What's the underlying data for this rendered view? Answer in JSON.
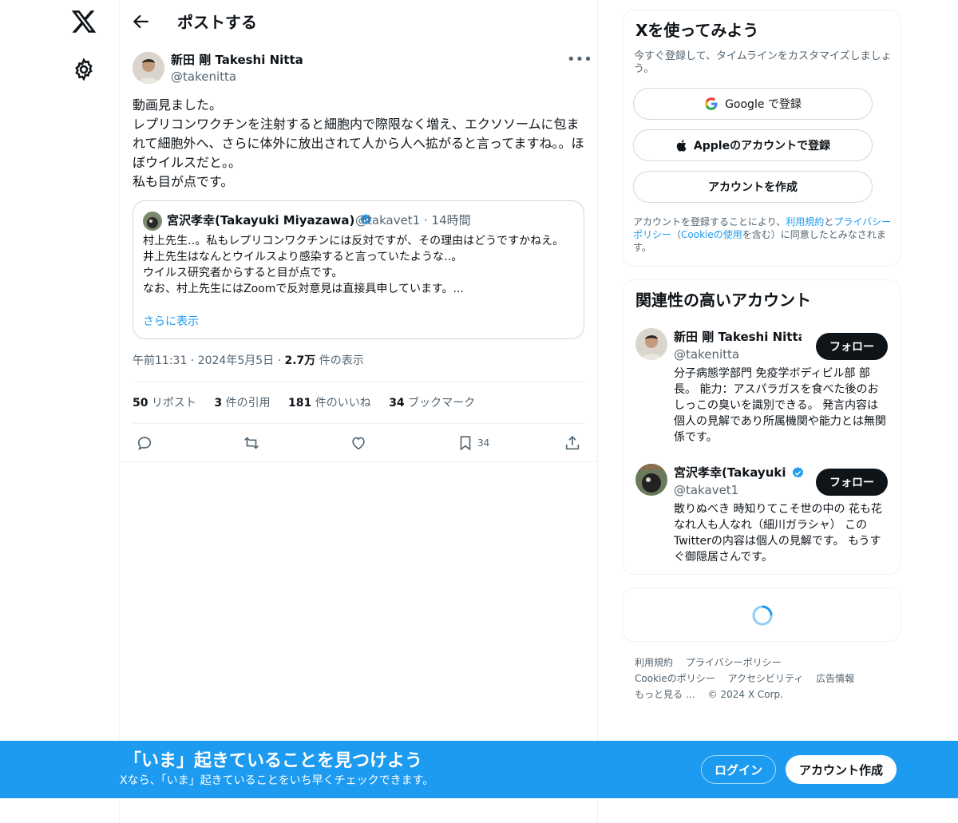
{
  "colors": {
    "accent": "#1d9bf0",
    "text": "#0f1419",
    "muted": "#536471",
    "border": "#eff3f4"
  },
  "nav": {
    "logo_icon": "x-logo-icon",
    "settings_icon": "gear-icon"
  },
  "header": {
    "title": "ポストする",
    "back_icon": "arrow-left-icon"
  },
  "post": {
    "author_name": "新田 剛 Takeshi Nitta",
    "author_handle": "@takenitta",
    "more_label": "•••",
    "text": "動画見ました。\nレプリコンワクチンを注射すると細胞内で際限なく増え、エクソソームに包まれて細胞外へ、さらに体外に放出されて人から人へ拡がると言ってますね。。ほぼウイルスだと。。\n私も目が点です。",
    "quote": {
      "author_name": "宮沢孝幸(Takayuki Miyazawa)",
      "author_handle": "@takavet1",
      "time": "14時間",
      "text": "村上先生‥。私もレプリコンワクチンには反対ですが、その理由はどうですかねえ。\n井上先生はなんとウイルスより感染すると言っていたような‥。\nウイルス研究者からすると目が点です。\nなお、村上先生にはZoomで反対意見は直接具申しています。...",
      "show_more": "さらに表示"
    },
    "timestamp": "午前11:31 · 2024年5月5日 · ",
    "views_count": "2.7万",
    "views_label": " 件の表示",
    "stats": [
      {
        "count": "50",
        "label": " リポスト"
      },
      {
        "count": "3",
        "label": " 件の引用"
      },
      {
        "count": "181",
        "label": " 件のいいね"
      },
      {
        "count": "34",
        "label": " ブックマーク"
      }
    ],
    "bookmark_count": "34"
  },
  "signup": {
    "title": "Xを使ってみよう",
    "subtitle": "今すぐ登録して、タイムラインをカスタマイズしましょう。",
    "google_label": "Google で登録",
    "apple_label": "Appleのアカウントで登録",
    "create_label": "アカウントを作成",
    "terms_pre": "アカウントを登録することにより、",
    "terms_link": "利用規約",
    "terms_and": "と",
    "privacy_link": "プライバシーポリシー",
    "terms_mid": "（",
    "cookie_link": "Cookieの使用",
    "terms_post": "を含む）に同意したとみなされます。"
  },
  "relevant": {
    "title": "関連性の高いアカウント",
    "accounts": [
      {
        "name": "新田 剛 Takeshi Nitta",
        "handle": "@takenitta",
        "follow": "フォロー",
        "bio": "分子病態学部門 免疫学ボディビル部 部長。 能力：アスパラガスを食べた後のおしっこの臭いを識別できる。 発言内容は個人の見解であり所属機関や能力とは無関係です。"
      },
      {
        "name": "宮沢孝幸(Takayuki Miyazawa)",
        "handle": "@takavet1",
        "follow": "フォロー",
        "bio": "散りぬべき 時知りてこそ世の中の 花も花なれ人も人なれ（細川ガラシャ） このTwitterの内容は個人の見解です。 もうすぐ御隠居さんです。"
      }
    ]
  },
  "footer": {
    "links_row1": [
      "利用規約",
      "プライバシーポリシー"
    ],
    "links_row2": [
      "Cookieのポリシー",
      "アクセシビリティ",
      "広告情報"
    ],
    "more": "もっと見る …",
    "copyright": "© 2024 X Corp."
  },
  "banner": {
    "title": "「いま」起きていることを見つけよう",
    "subtitle": "Xなら、「いま」起きていることをいち早くチェックできます。",
    "login": "ログイン",
    "signup": "アカウント作成"
  }
}
